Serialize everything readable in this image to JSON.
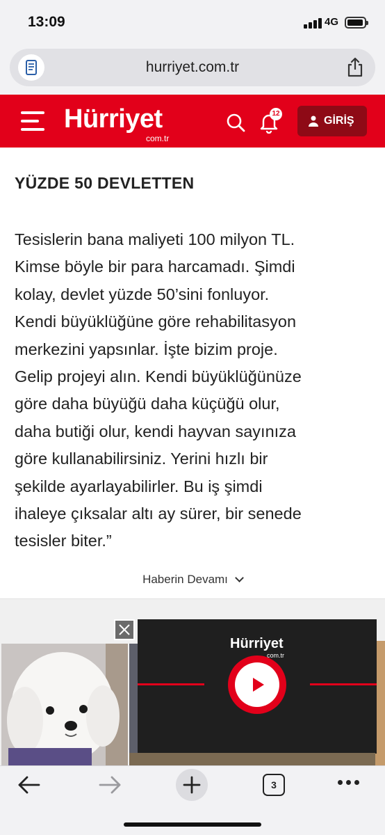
{
  "status_bar": {
    "time": "13:09",
    "network": "4G"
  },
  "browser": {
    "url": "hurriyet.com.tr",
    "open_tabs": "3"
  },
  "header": {
    "logo": "Hürriyet",
    "logo_sub": "com.tr",
    "notification_count": "12",
    "login_label": "GİRİŞ",
    "brand_color": "#e2001a"
  },
  "article": {
    "subheading": "YÜZDE 50 DEVLETTEN",
    "lines": [
      "Tesislerin bana maliyeti 100 milyon TL.",
      "Kimse böyle bir para harcamadı. Şimdi",
      "kolay, devlet yüzde 50’sini fonluyor.",
      "Kendi büyüklüğüne göre rehabilitasyon",
      "merkezini yapsınlar. İşte bizim proje.",
      "Gelip projeyi alın. Kendi büyüklüğünüze",
      "göre daha büyüğü daha küçüğü olur,",
      "daha butiği olur, kendi hayvan sayınıza",
      "göre kullanabilirsiniz. Yerini hızlı bir",
      "şekilde ayarlayabilirler. Bu iş şimdi",
      "ihaleye çıksalar altı ay sürer, bir senede",
      "tesisler biter.”"
    ],
    "more_label": "Haberin Devamı"
  },
  "ad": {
    "player_logo": "Hürriyet",
    "player_logo_sub": "com.tr",
    "icons": [
      "close-icon",
      "play-icon"
    ]
  },
  "toolbar": {
    "icons": [
      "back-arrow-icon",
      "forward-arrow-icon",
      "plus-icon",
      "tabs-icon",
      "more-icon"
    ]
  }
}
